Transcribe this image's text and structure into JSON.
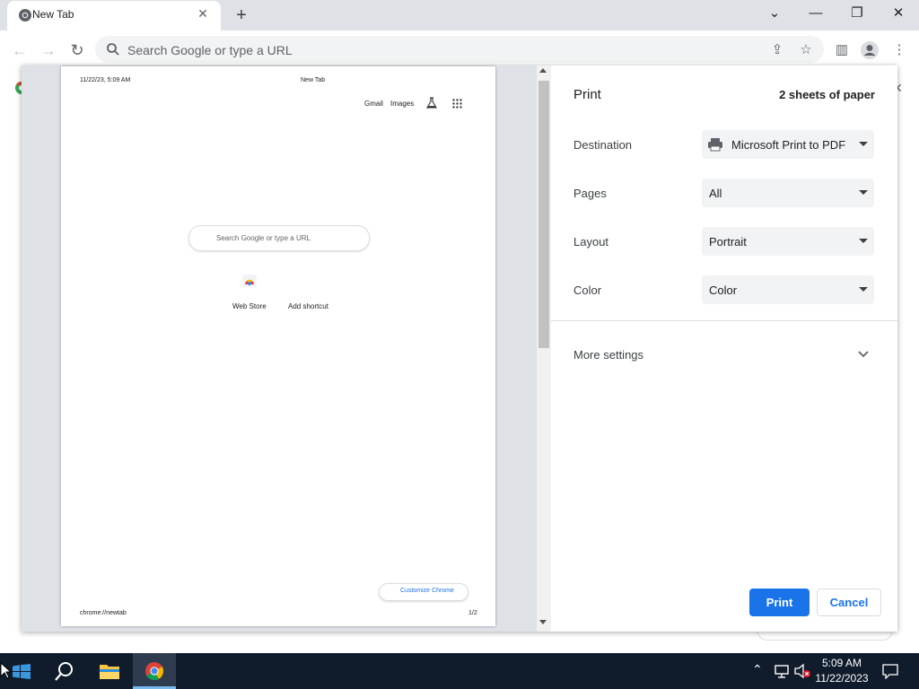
{
  "browser": {
    "tab_title": "New Tab",
    "omnibox_placeholder": "Search Google or type a URL"
  },
  "preview": {
    "header_datetime": "11/22/23, 5:09 AM",
    "header_title": "New Tab",
    "gmail": "Gmail",
    "images": "Images",
    "search_placeholder": "Search Google or type a URL",
    "shortcut_web_store": "Web Store",
    "shortcut_add": "Add shortcut",
    "customize": "Customize Chrome",
    "footer_url": "chrome://newtab",
    "footer_page": "1/2"
  },
  "print": {
    "title": "Print",
    "sheets": "2 sheets of paper",
    "destination_label": "Destination",
    "destination_value": "Microsoft Print to PDF",
    "pages_label": "Pages",
    "pages_value": "All",
    "layout_label": "Layout",
    "layout_value": "Portrait",
    "color_label": "Color",
    "color_value": "Color",
    "more_settings": "More settings",
    "print_button": "Print",
    "cancel_button": "Cancel"
  },
  "taskbar": {
    "time": "5:09 AM",
    "date": "11/22/2023"
  },
  "colors": {
    "accent": "#1a73e8",
    "taskbar": "#101c2c"
  }
}
